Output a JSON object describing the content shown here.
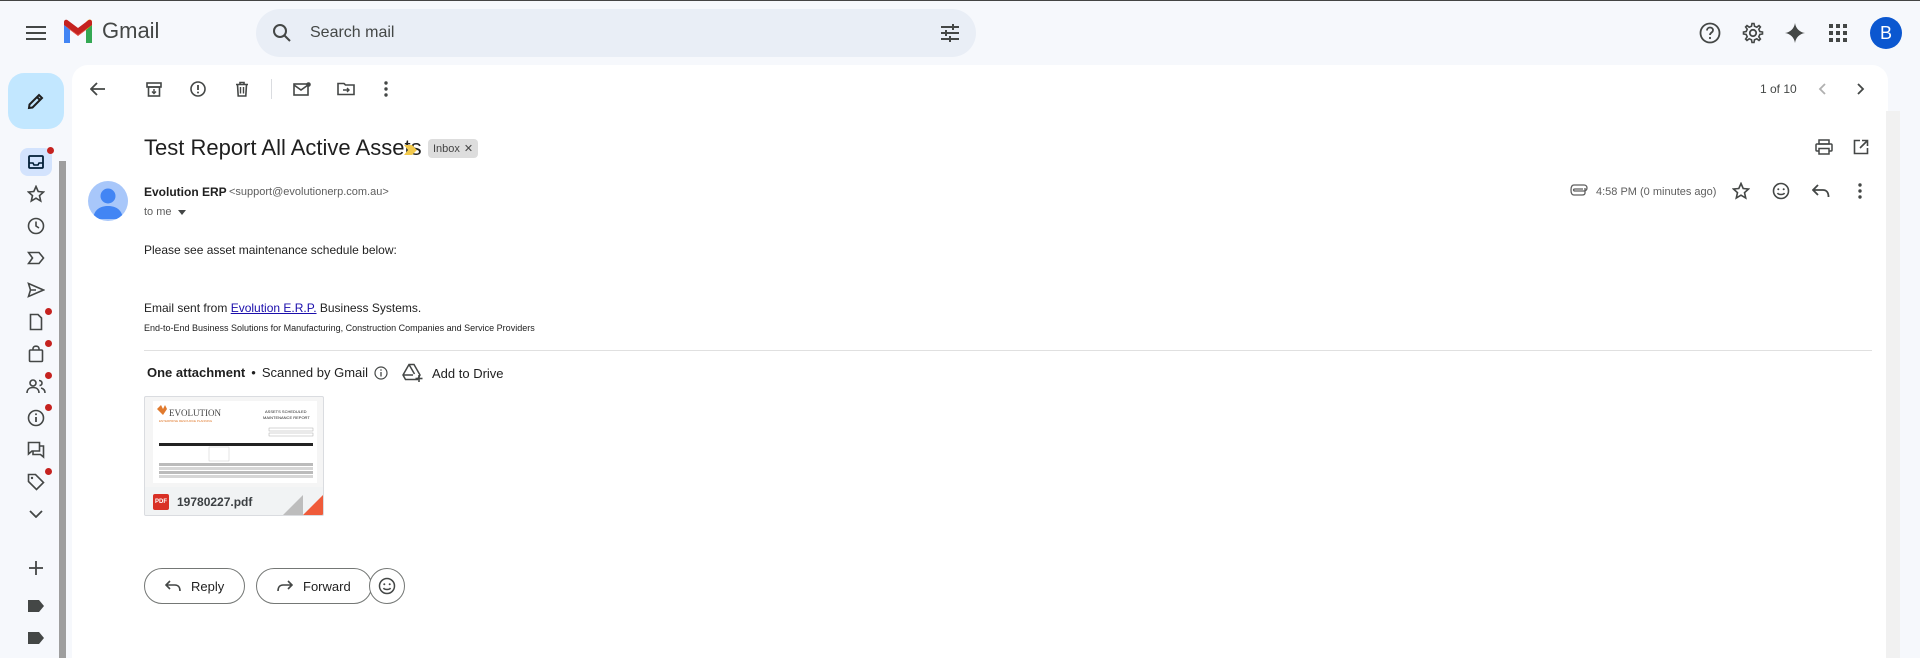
{
  "app": {
    "name": "Gmail"
  },
  "search": {
    "placeholder": "Search mail"
  },
  "account": {
    "initial": "B"
  },
  "toolbar": {
    "pager": "1 of 10"
  },
  "email": {
    "subject": "Test Report All Active Assets",
    "label": "Inbox",
    "sender_name": "Evolution ERP",
    "sender_email": "<support@evolutionerp.com.au>",
    "to": "to me",
    "timestamp": "4:58 PM (0 minutes ago)",
    "body_line1": "Please see asset maintenance schedule below:",
    "body_line2_prefix": "Email sent from ",
    "body_link": "Evolution E.R.P.",
    "body_line2_suffix": " Business Systems.",
    "body_line3": "End-to-End Business Solutions for Manufacturing, Construction Companies and Service Providers"
  },
  "attachments": {
    "heading": "One attachment",
    "separator": "•",
    "scanned": "Scanned by Gmail",
    "add_drive": "Add to Drive",
    "file_name": "19780227.pdf",
    "file_type": "PDF",
    "thumb_logo": "EVOLUTION",
    "thumb_tagline": "ENTERPRISE RESOURCE PLANNING",
    "thumb_title_line1": "ASSETS SCHEDULED",
    "thumb_title_line2": "MAINTENANCE REPORT"
  },
  "actions": {
    "reply": "Reply",
    "forward": "Forward"
  },
  "colors": {
    "accent": "#0b57d0",
    "compose": "#c2e7ff",
    "badge": "#c5221f",
    "importance": "#f2c94c"
  }
}
